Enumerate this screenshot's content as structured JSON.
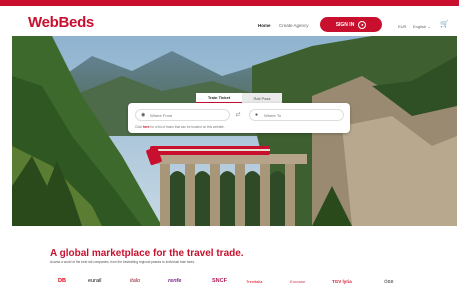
{
  "brand": {
    "logo": "WebBeds",
    "accent": "#c8102e"
  },
  "nav": {
    "home": "Home",
    "agency": "Create Agency",
    "signin": "SIGN IN",
    "currency": "EUR",
    "language": "English ⌄"
  },
  "search": {
    "tabs": [
      {
        "label": "Train Ticket"
      },
      {
        "label": "Rail Pass"
      }
    ],
    "from_placeholder": "Where From",
    "to_placeholder": "Where To",
    "note_pre": "Click",
    "note_link": "here",
    "note_post": "for a list of trains that can be booked on this website."
  },
  "marketing": {
    "headline": "A global marketplace for the travel trade.",
    "sub": "Access a world of the best rail companies, from the bestselling regional passes to individual train fares."
  },
  "partners": [
    {
      "name": "DB",
      "color": "#e2001a"
    },
    {
      "name": "eurail",
      "color": "#111111"
    },
    {
      "name": "italo",
      "color": "#8b1c2b"
    },
    {
      "name": "renfe",
      "color": "#7d2a8a"
    },
    {
      "name": "SNCF",
      "color": "#b01d5a"
    },
    {
      "name": "Trenitalia",
      "color": "#e2001a"
    },
    {
      "name": "Eurostar",
      "color": "#cc3355"
    },
    {
      "name": "TGV lyria",
      "color": "#cc2233"
    },
    {
      "name": "ÖBB",
      "color": "#444444"
    }
  ]
}
